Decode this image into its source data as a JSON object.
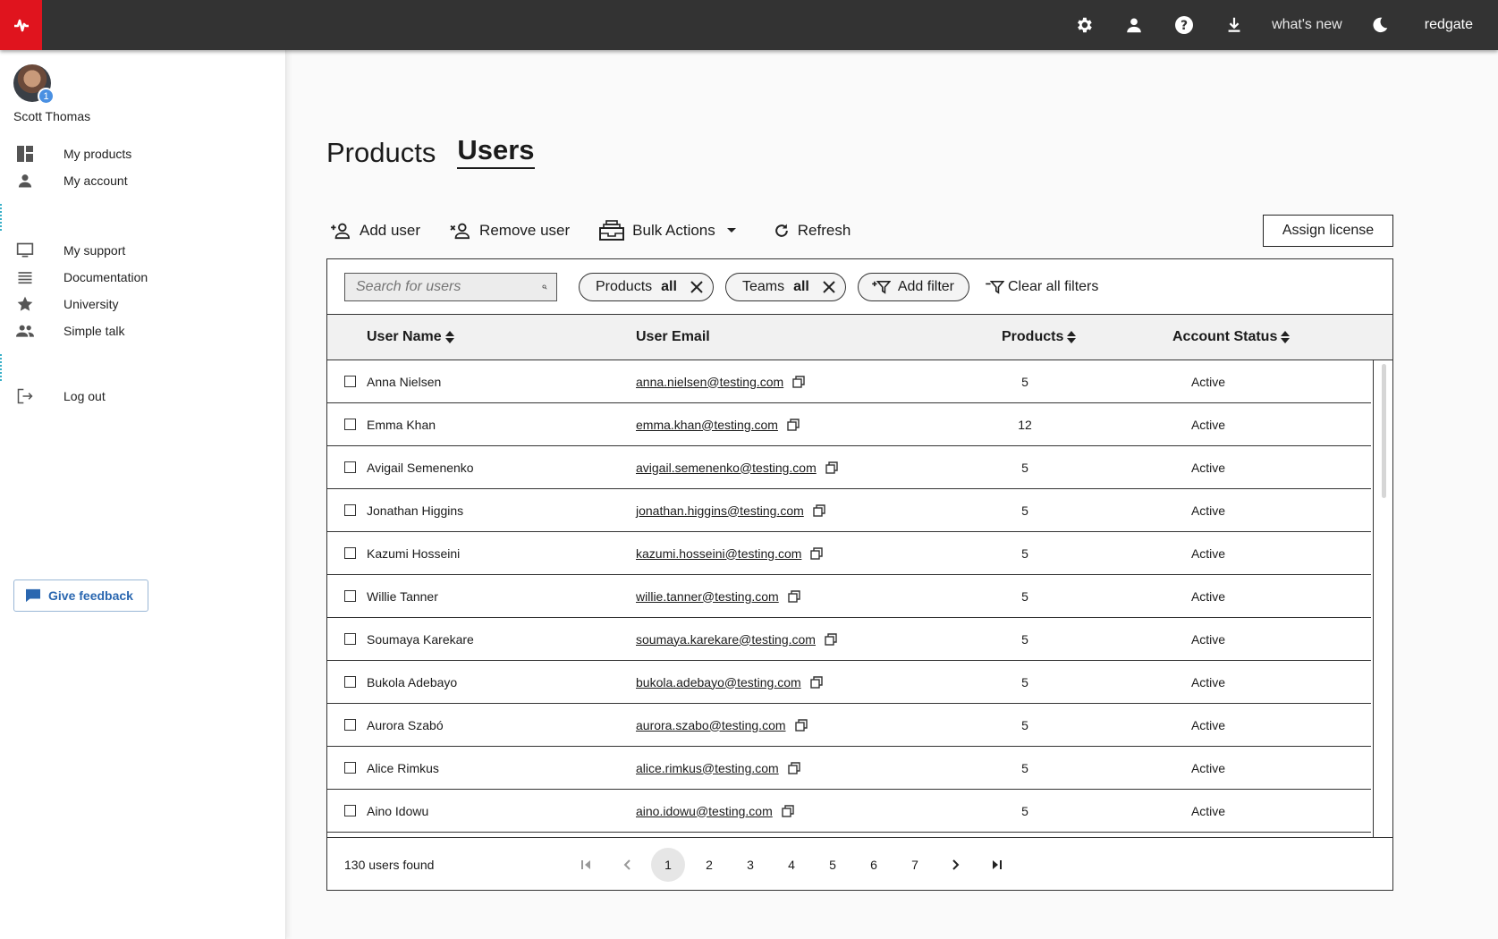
{
  "topbar": {
    "whats_new": "what's new",
    "brand": "redgate",
    "icons": [
      "settings-icon",
      "user-icon",
      "help-icon",
      "download-icon",
      "dark-mode-icon"
    ]
  },
  "sidebar": {
    "user_name": "Scott Thomas",
    "notification_count": "1",
    "items": [
      {
        "label": "My products",
        "icon": "dashboard-icon"
      },
      {
        "label": "My account",
        "icon": "person-icon"
      },
      {
        "label": "My support",
        "icon": "monitor-icon"
      },
      {
        "label": "Documentation",
        "icon": "list-icon"
      },
      {
        "label": "University",
        "icon": "star-icon"
      },
      {
        "label": "Simple talk",
        "icon": "people-icon"
      },
      {
        "label": "Log out",
        "icon": "logout-icon"
      }
    ],
    "feedback_label": "Give feedback"
  },
  "tabs": [
    {
      "label": "Products",
      "active": false
    },
    {
      "label": "Users",
      "active": true
    }
  ],
  "toolbar": {
    "add_user": "Add user",
    "remove_user": "Remove user",
    "bulk_actions": "Bulk Actions",
    "refresh": "Refresh",
    "assign_license": "Assign license"
  },
  "filters": {
    "search_placeholder": "Search for users",
    "chips": [
      {
        "name": "Products",
        "value": "all"
      },
      {
        "name": "Teams",
        "value": "all"
      }
    ],
    "add_filter": "Add filter",
    "clear_all": "Clear all filters"
  },
  "table": {
    "columns": [
      "User Name",
      "User Email",
      "Products",
      "Account Status"
    ],
    "rows": [
      {
        "name": "Anna Nielsen",
        "email": "anna.nielsen@testing.com",
        "products": "5",
        "status": "Active"
      },
      {
        "name": "Emma Khan",
        "email": "emma.khan@testing.com",
        "products": "12",
        "status": "Active"
      },
      {
        "name": "Avigail Semenenko",
        "email": "avigail.semenenko@testing.com",
        "products": "5",
        "status": "Active"
      },
      {
        "name": "Jonathan Higgins",
        "email": "jonathan.higgins@testing.com",
        "products": "5",
        "status": "Active"
      },
      {
        "name": "Kazumi Hosseini",
        "email": "kazumi.hosseini@testing.com",
        "products": "5",
        "status": "Active"
      },
      {
        "name": "Willie Tanner",
        "email": "willie.tanner@testing.com",
        "products": "5",
        "status": "Active"
      },
      {
        "name": "Soumaya Karekare",
        "email": "soumaya.karekare@testing.com",
        "products": "5",
        "status": "Active"
      },
      {
        "name": "Bukola Adebayo",
        "email": "bukola.adebayo@testing.com",
        "products": "5",
        "status": "Active"
      },
      {
        "name": "Aurora Szabó",
        "email": "aurora.szabo@testing.com",
        "products": "5",
        "status": "Active"
      },
      {
        "name": "Alice Rimkus",
        "email": "alice.rimkus@testing.com",
        "products": "5",
        "status": "Active"
      },
      {
        "name": "Aino Idowu",
        "email": "aino.idowu@testing.com",
        "products": "5",
        "status": "Active"
      }
    ]
  },
  "footer": {
    "found": "130 users found",
    "pages": [
      "1",
      "2",
      "3",
      "4",
      "5",
      "6",
      "7"
    ],
    "current_page": "1"
  },
  "colors": {
    "topbar": "#333333",
    "brand_red": "#e0141e",
    "badge_blue": "#4a90e2",
    "feedback_blue": "#2a67b0"
  }
}
